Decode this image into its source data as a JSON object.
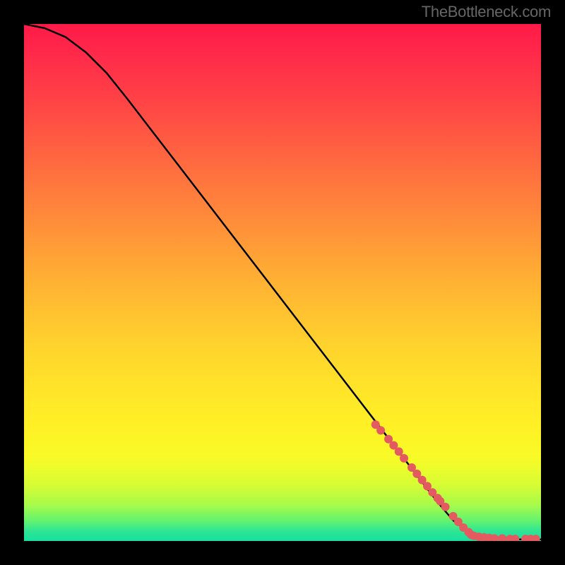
{
  "attribution": "TheBottleneck.com",
  "colors": {
    "curve": "#000000",
    "dot_fill": "#e35b60",
    "dot_stroke": "#e35b60"
  },
  "chart_data": {
    "type": "line",
    "title": "",
    "xlabel": "",
    "ylabel": "",
    "xlim": [
      0,
      100
    ],
    "ylim": [
      0,
      100
    ],
    "grid": false,
    "series": [
      {
        "name": "curve",
        "style": "line",
        "x": [
          0,
          4,
          8,
          12,
          16,
          20,
          25,
          30,
          35,
          40,
          45,
          50,
          55,
          60,
          65,
          70,
          75,
          80,
          83,
          86,
          89,
          92,
          95,
          98,
          100
        ],
        "y": [
          100,
          99.2,
          97.5,
          94.5,
          90.5,
          85.5,
          79,
          72.5,
          66,
          59.5,
          53,
          46.5,
          40,
          33.5,
          27,
          20.5,
          14,
          7.5,
          4,
          1.7,
          0.7,
          0.4,
          0.3,
          0.3,
          0.3
        ]
      },
      {
        "name": "dots",
        "style": "scatter",
        "x": [
          68,
          69,
          70.5,
          71.5,
          72.5,
          73.5,
          75,
          76,
          77,
          78,
          79,
          80,
          80.5,
          81.5,
          83,
          84,
          85,
          86,
          86.5,
          87,
          88,
          89,
          90,
          91,
          92.5,
          94,
          95,
          97,
          98,
          99
        ],
        "y": [
          22.5,
          21.4,
          19.7,
          18.5,
          17.3,
          16.0,
          14.2,
          13.0,
          11.8,
          10.6,
          9.4,
          8.3,
          7.7,
          6.6,
          4.8,
          3.7,
          2.6,
          1.7,
          1.2,
          1.0,
          0.8,
          0.7,
          0.6,
          0.5,
          0.5,
          0.4,
          0.4,
          0.4,
          0.4,
          0.4
        ]
      }
    ]
  }
}
